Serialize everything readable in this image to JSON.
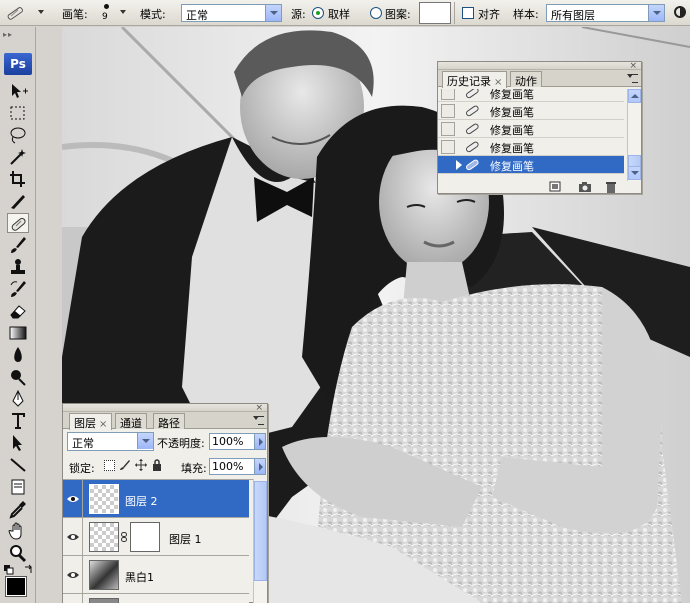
{
  "options_bar": {
    "brush_label": "画笔:",
    "brush_size": "9",
    "mode_label": "模式:",
    "mode_value": "正常",
    "source_label": "源:",
    "source_sampled": "取样",
    "source_pattern": "图案:",
    "aligned_label": "对齐",
    "sample_label": "样本:",
    "sample_value": "所有图层"
  },
  "toolbox": {
    "logo": "Ps"
  },
  "history_panel": {
    "tabs": [
      {
        "label": "历史记录",
        "active": true
      },
      {
        "label": "动作",
        "active": false
      }
    ],
    "close_glyph": "×",
    "items": [
      {
        "label": "修复画笔",
        "selected": false
      },
      {
        "label": "修复画笔",
        "selected": false
      },
      {
        "label": "修复画笔",
        "selected": false
      },
      {
        "label": "修复画笔",
        "selected": false
      },
      {
        "label": "修复画笔",
        "selected": true
      }
    ],
    "footer_icons": [
      "new-document-from-state-icon",
      "new-snapshot-icon",
      "trash-icon"
    ]
  },
  "layers_panel": {
    "tabs": [
      {
        "label": "图层",
        "active": true
      },
      {
        "label": "通道",
        "active": false
      },
      {
        "label": "路径",
        "active": false
      }
    ],
    "close_glyph": "×",
    "blend_mode": "正常",
    "opacity_label": "不透明度:",
    "opacity_value": "100%",
    "lock_label": "锁定:",
    "fill_label": "填充:",
    "fill_value": "100%",
    "layers": [
      {
        "name": "图层 2",
        "selected": true,
        "visible": true,
        "has_mask": false
      },
      {
        "name": "图层 1",
        "selected": false,
        "visible": true,
        "has_mask": true
      },
      {
        "name": "黑白1",
        "selected": false,
        "visible": true,
        "has_mask": false
      }
    ]
  },
  "colors": {
    "selection_blue": "#316ac5",
    "panel_bg": "#f0efea",
    "chrome_bg": "#d6d3ce"
  }
}
